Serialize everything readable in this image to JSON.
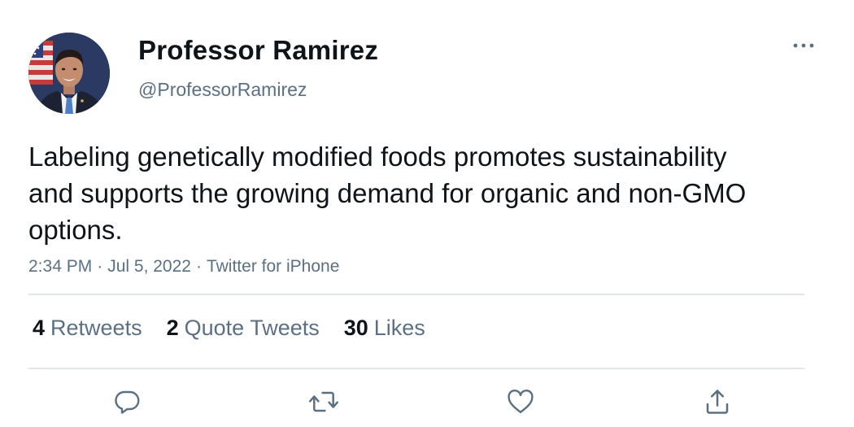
{
  "author": {
    "display_name": "Professor Ramirez",
    "handle": "@ProfessorRamirez"
  },
  "tweet": {
    "text": "Labeling genetically modified foods promotes sustainability and supports the growing demand for organic and non-GMO options.",
    "time": "2:34 PM",
    "date": "Jul 5, 2022",
    "source": "Twitter for iPhone",
    "separator": "·"
  },
  "stats": {
    "retweets": {
      "count": "4",
      "label": "Retweets"
    },
    "quote_tweets": {
      "count": "2",
      "label": "Quote Tweets"
    },
    "likes": {
      "count": "30",
      "label": "Likes"
    }
  },
  "icons": {
    "more": "more-dots-icon",
    "reply": "reply-icon",
    "retweet": "retweet-icon",
    "like": "heart-icon",
    "share": "share-icon"
  },
  "colors": {
    "text_primary": "#0f1419",
    "text_secondary": "#5b7083",
    "divider": "#e1e6ea"
  }
}
